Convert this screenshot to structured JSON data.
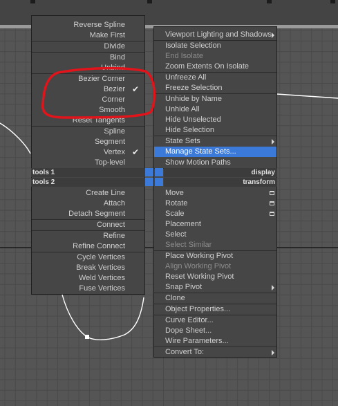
{
  "left_menu": {
    "items": [
      {
        "label": "Reverse Spline",
        "disabled": false
      },
      {
        "label": "Make First",
        "disabled": false
      },
      {
        "label": "Divide",
        "disabled": false
      },
      {
        "label": "Bind",
        "disabled": false
      },
      {
        "label": "Unbind",
        "disabled": false
      },
      {
        "label": "Bezier Corner",
        "disabled": false
      },
      {
        "label": "Bezier",
        "disabled": false
      },
      {
        "label": "Corner",
        "disabled": false
      },
      {
        "label": "Smooth",
        "disabled": false
      },
      {
        "label": "Reset Tangents",
        "disabled": false
      },
      {
        "label": "Spline",
        "disabled": false
      },
      {
        "label": "Segment",
        "disabled": false
      },
      {
        "label": "Vertex",
        "disabled": false
      },
      {
        "label": "Top-level",
        "disabled": false
      },
      {
        "label": "Create Line",
        "disabled": false
      },
      {
        "label": "Attach",
        "disabled": false
      },
      {
        "label": "Detach Segment",
        "disabled": false
      },
      {
        "label": "Connect",
        "disabled": false
      },
      {
        "label": "Refine",
        "disabled": false
      },
      {
        "label": "Refine Connect",
        "disabled": false
      },
      {
        "label": "Cycle Vertices",
        "disabled": false
      },
      {
        "label": "Break Vertices",
        "disabled": false
      },
      {
        "label": "Weld Vertices",
        "disabled": false
      },
      {
        "label": "Fuse Vertices",
        "disabled": false
      }
    ]
  },
  "right_menu": {
    "items": [
      {
        "label": "Viewport Lighting and Shadows",
        "disabled": false
      },
      {
        "label": "Isolate Selection",
        "disabled": false
      },
      {
        "label": "End Isolate",
        "disabled": true
      },
      {
        "label": "Zoom Extents On Isolate",
        "disabled": false
      },
      {
        "label": "Unfreeze All",
        "disabled": false
      },
      {
        "label": "Freeze Selection",
        "disabled": false
      },
      {
        "label": "Unhide by Name",
        "disabled": false
      },
      {
        "label": "Unhide All",
        "disabled": false
      },
      {
        "label": "Hide Unselected",
        "disabled": false
      },
      {
        "label": "Hide Selection",
        "disabled": false
      },
      {
        "label": "State Sets",
        "disabled": false
      },
      {
        "label": "Manage State Sets...",
        "disabled": false
      },
      {
        "label": "Show Motion Paths",
        "disabled": false
      },
      {
        "label": "Move",
        "disabled": false
      },
      {
        "label": "Rotate",
        "disabled": false
      },
      {
        "label": "Scale",
        "disabled": false
      },
      {
        "label": "Placement",
        "disabled": false
      },
      {
        "label": "Select",
        "disabled": false
      },
      {
        "label": "Select Similar",
        "disabled": true
      },
      {
        "label": "Place Working Pivot",
        "disabled": false
      },
      {
        "label": "Align Working Pivot",
        "disabled": true
      },
      {
        "label": "Reset Working Pivot",
        "disabled": false
      },
      {
        "label": "Snap Pivot",
        "disabled": false
      },
      {
        "label": "Clone",
        "disabled": false
      },
      {
        "label": "Object Properties...",
        "disabled": false
      },
      {
        "label": "Curve Editor...",
        "disabled": false
      },
      {
        "label": "Dope Sheet...",
        "disabled": false
      },
      {
        "label": "Wire Parameters...",
        "disabled": false
      },
      {
        "label": "Convert To:",
        "disabled": false
      }
    ]
  },
  "quad_labels": {
    "tools1": "tools 1",
    "tools2": "tools 2",
    "display": "display",
    "transform": "transform"
  },
  "checked_items": [
    "Bezier",
    "Vertex"
  ],
  "highlighted_item": "Manage State Sets...",
  "colors": {
    "highlight": "#3b7ad9",
    "annotation": "#e0141a",
    "viewport_bg": "#555555"
  }
}
